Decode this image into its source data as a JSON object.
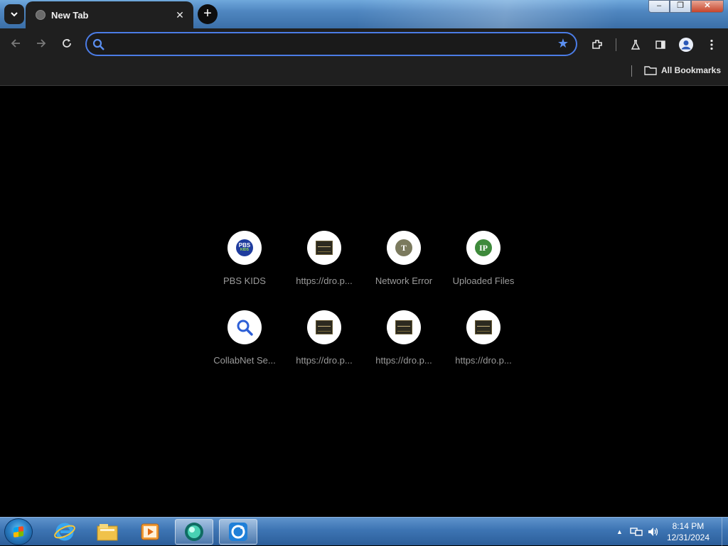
{
  "tab": {
    "title": "New Tab",
    "close_label": "✕"
  },
  "newtab_label": "+",
  "window_controls": {
    "minimize": "–",
    "restore": "❐",
    "close": "✕"
  },
  "omnibox": {
    "value": "",
    "placeholder": ""
  },
  "bookmarks": {
    "all_label": "All Bookmarks"
  },
  "shortcuts": [
    {
      "label": "PBS KIDS",
      "icon": "pbs-kids-logo"
    },
    {
      "label": "https://dro.p...",
      "icon": "site-thumbnail"
    },
    {
      "label": "Network Error",
      "icon": "letter-t",
      "letter": "T",
      "color": "#7b7a5e"
    },
    {
      "label": "Uploaded Files",
      "icon": "letter-ip",
      "letter": "IP",
      "color": "#3e8a3b"
    },
    {
      "label": "CollabNet Se...",
      "icon": "search-icon"
    },
    {
      "label": "https://dro.p...",
      "icon": "site-thumbnail"
    },
    {
      "label": "https://dro.p...",
      "icon": "site-thumbnail"
    },
    {
      "label": "https://dro.p...",
      "icon": "site-thumbnail"
    }
  ],
  "pbs_text": {
    "top": "PBS",
    "bottom": "KIDS"
  },
  "taskbar": {
    "apps": [
      "internet-explorer",
      "file-explorer",
      "media-player",
      "browser-chromium",
      "sync-app"
    ],
    "time": "8:14 PM",
    "date": "12/31/2024"
  },
  "colors": {
    "accent": "#4b7ce6",
    "star": "#5b8ff0"
  }
}
